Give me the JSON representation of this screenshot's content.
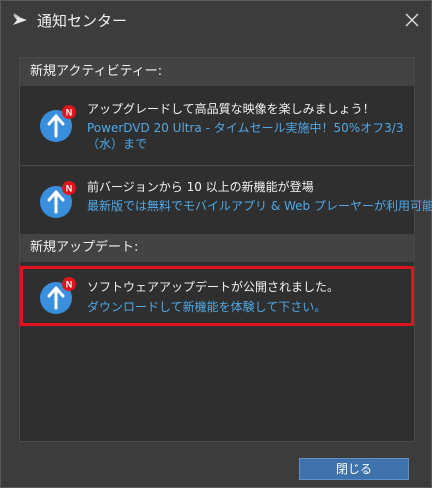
{
  "window": {
    "title": "通知センター"
  },
  "sections": {
    "activity": {
      "header": "新規アクティビティー:",
      "items": [
        {
          "line1": "アップグレードして高品質な映像を楽しみましょう！",
          "line2": "PowerDVD 20 Ultra - タイムセール実施中！50%オフ3/3（水）まで"
        },
        {
          "line1": "前バージョンから 10 以上の新機能が登場",
          "line2": "最新版では無料でモバイルアプリ & Web プレーヤーが利用可能"
        }
      ]
    },
    "updates": {
      "header": "新規アップデート:",
      "items": [
        {
          "line1": "ソフトウェアアップデートが公開されました。",
          "line2": "ダウンロードして新機能を体験して下さい。"
        }
      ]
    }
  },
  "footer": {
    "close_label": "閉じる"
  },
  "colors": {
    "accent": "#4fa8e6",
    "badge": "#e0141e",
    "icon_blue": "#3a8fdc",
    "button": "#3f72ad"
  },
  "icons": {
    "app": "cyberlink-app-icon",
    "close": "close-icon",
    "update": "upload-arrow-icon",
    "badge": "new-badge-icon"
  }
}
